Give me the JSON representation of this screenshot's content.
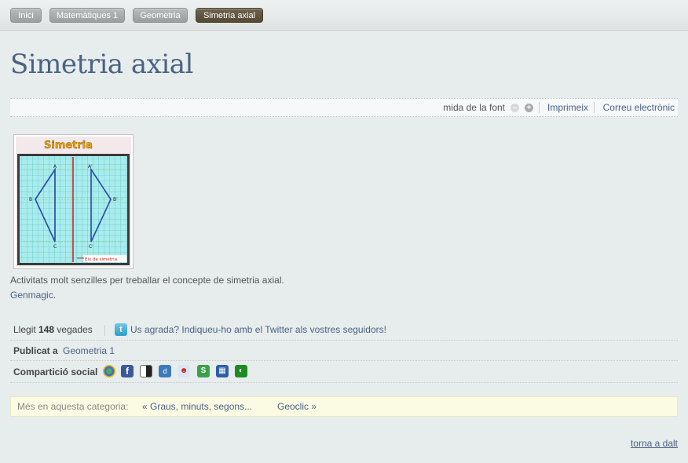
{
  "breadcrumb": [
    "Inici",
    "Matemàtiques 1",
    "Geometria",
    "Simetria axial"
  ],
  "page_title": "Simetria axial",
  "tools": {
    "font_size_label": "mida de la font",
    "print": "Imprimeix",
    "email": "Correu electrònic"
  },
  "image": {
    "heading": "Simetria",
    "labels": [
      "A",
      "A'",
      "B",
      "B'",
      "C",
      "C'"
    ],
    "axis_label": "Eix de simetria"
  },
  "description": "Activitats molt senzilles per treballar el concepte de simetria axial.",
  "source": "Genmagic.",
  "meta": {
    "read_prefix": "Llegit",
    "read_count": "148",
    "read_suffix": "vegades",
    "twitter_text": "Us agrada? Indiqueu-ho amb el Twitter als vostres seguidors!",
    "published_label": "Publicat a",
    "published_category": "Geometria 1",
    "social_label": "Compartició social",
    "social_icons": [
      "google-buzz-icon",
      "facebook-icon",
      "delicious-icon",
      "digg-icon",
      "reddit-icon",
      "stumbleupon-icon",
      "myspace-icon",
      "technorati-icon"
    ]
  },
  "navigation": {
    "label": "Més en aquesta categoria:",
    "prev": "« Graus, minuts, segons...",
    "next": "Geoclic »"
  },
  "back_to_top": "torna a dalt",
  "colors": {
    "link": "#4a6285",
    "background": "#e7ecec",
    "active_crumb": "#55492f"
  }
}
